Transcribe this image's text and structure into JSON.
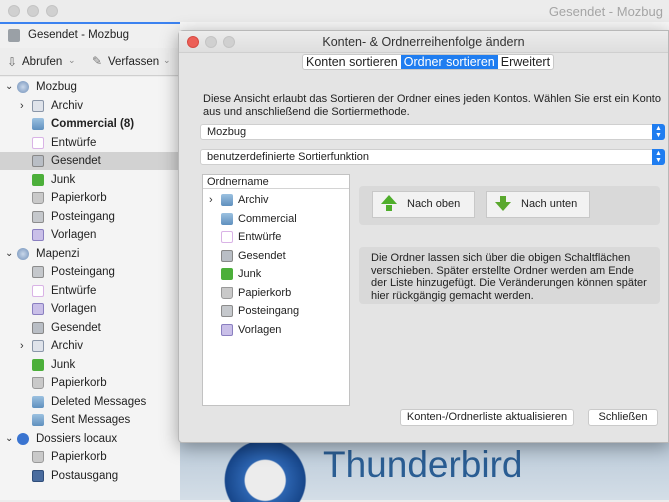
{
  "window": {
    "title": "Gesendet - Mozbug",
    "tab_label": "Gesendet - Mozbug"
  },
  "toolbar": {
    "get_mail": "Abrufen",
    "compose": "Verfassen"
  },
  "folder_pane": {
    "accounts": [
      {
        "name": "Mozbug",
        "folders": [
          {
            "label": "Archiv",
            "icon": "archive-icon",
            "expandable": true
          },
          {
            "label": "Commercial (8)",
            "icon": "folder-icon",
            "bold": true
          },
          {
            "label": "Entwürfe",
            "icon": "drafts-icon"
          },
          {
            "label": "Gesendet",
            "icon": "sent-icon",
            "selected": true
          },
          {
            "label": "Junk",
            "icon": "junk-icon"
          },
          {
            "label": "Papierkorb",
            "icon": "trash-icon"
          },
          {
            "label": "Posteingang",
            "icon": "inbox-icon"
          },
          {
            "label": "Vorlagen",
            "icon": "templates-icon"
          }
        ]
      },
      {
        "name": "Mapenzi",
        "folders": [
          {
            "label": "Posteingang",
            "icon": "inbox-icon"
          },
          {
            "label": "Entwürfe",
            "icon": "drafts-icon"
          },
          {
            "label": "Vorlagen",
            "icon": "templates-icon"
          },
          {
            "label": "Gesendet",
            "icon": "sent-icon"
          },
          {
            "label": "Archiv",
            "icon": "archive-icon",
            "expandable": true
          },
          {
            "label": "Junk",
            "icon": "junk-icon"
          },
          {
            "label": "Papierkorb",
            "icon": "trash-icon"
          },
          {
            "label": "Deleted Messages",
            "icon": "folder-icon"
          },
          {
            "label": "Sent Messages",
            "icon": "folder-icon"
          }
        ]
      },
      {
        "name": "Dossiers locaux",
        "folders": [
          {
            "label": "Papierkorb",
            "icon": "trash-icon"
          },
          {
            "label": "Postausgang",
            "icon": "outbox-icon"
          }
        ]
      }
    ]
  },
  "dialog": {
    "title": "Konten- & Ordnerreihenfolge ändern",
    "tabs": [
      "Konten sortieren",
      "Ordner sortieren",
      "Erweitert"
    ],
    "active_tab": 1,
    "description": "Diese Ansicht erlaubt das Sortieren der Ordner eines jeden Kontos. Wählen Sie erst ein Konto aus und anschließend die Sortiermethode.",
    "account_select": "Mozbug",
    "sort_select": "benutzerdefinierte Sortierfunktion",
    "tree_header": "Ordnername",
    "tree_items": [
      "Archiv",
      "Commercial",
      "Entwürfe",
      "Gesendet",
      "Junk",
      "Papierkorb",
      "Posteingang",
      "Vorlagen"
    ],
    "move_up": "Nach oben",
    "move_down": "Nach unten",
    "info": "Die Ordner lassen sich über die obigen Schaltflächen verschieben. Später erstellte Ordner werden am Ende der Liste hinzugefügt. Die Veränderungen können später hier rückgängig gemacht werden.",
    "refresh_button": "Konten-/Ordnerliste aktualisieren",
    "close_button": "Schließen"
  },
  "branding": {
    "logo_text": "Thunderbird"
  },
  "colors": {
    "accent": "#1f7df0",
    "close_light": "#ec5f57"
  }
}
